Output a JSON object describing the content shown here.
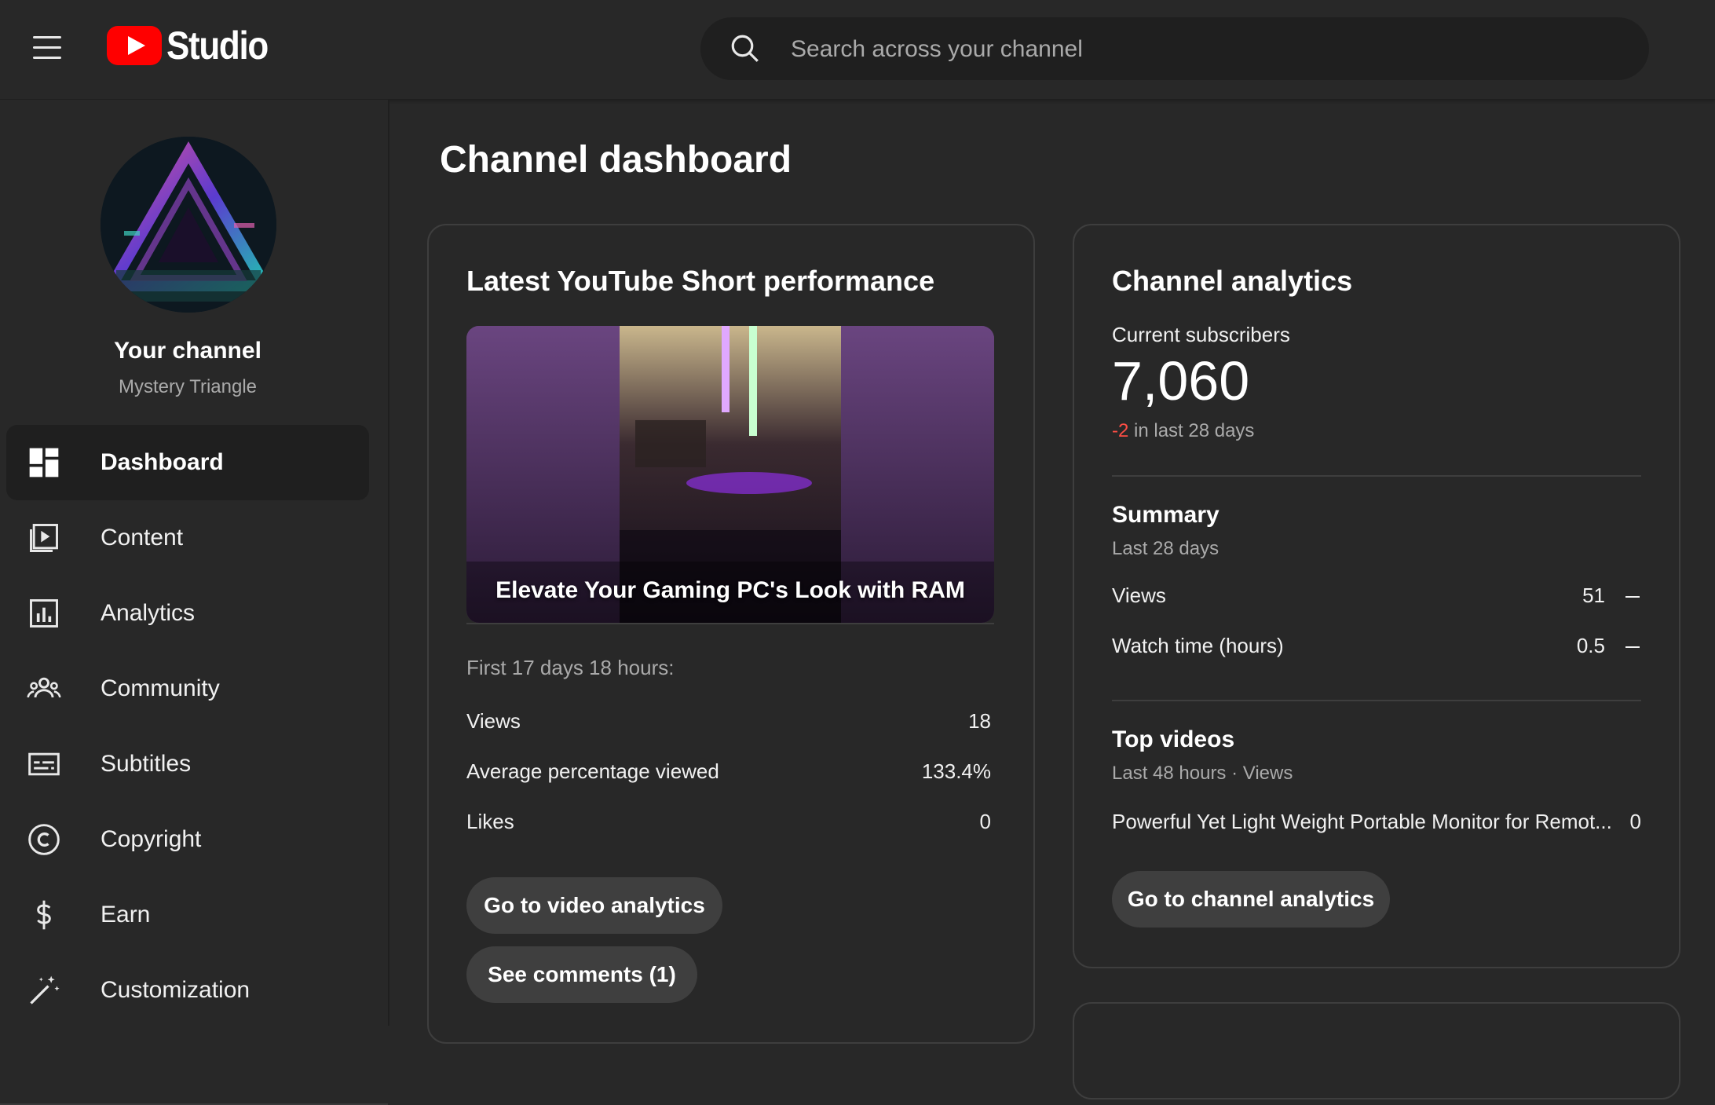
{
  "header": {
    "logo_text": "Studio",
    "search_placeholder": "Search across your channel"
  },
  "sidebar": {
    "channel_name": "Your channel",
    "channel_handle": "Mystery Triangle",
    "items": [
      {
        "label": "Dashboard",
        "icon": "dashboard-icon",
        "active": true
      },
      {
        "label": "Content",
        "icon": "content-icon"
      },
      {
        "label": "Analytics",
        "icon": "analytics-icon"
      },
      {
        "label": "Community",
        "icon": "community-icon"
      },
      {
        "label": "Subtitles",
        "icon": "subtitles-icon"
      },
      {
        "label": "Copyright",
        "icon": "copyright-icon"
      },
      {
        "label": "Earn",
        "icon": "earn-icon"
      },
      {
        "label": "Customization",
        "icon": "customization-icon"
      }
    ]
  },
  "main": {
    "title": "Channel dashboard",
    "short_card": {
      "title": "Latest YouTube Short performance",
      "video_title": "Elevate Your Gaming PC's Look with RAM",
      "period": "First 17 days 18 hours:",
      "stats": [
        {
          "label": "Views",
          "value": "18"
        },
        {
          "label": "Average percentage viewed",
          "value": "133.4%"
        },
        {
          "label": "Likes",
          "value": "0"
        }
      ],
      "buttons": [
        "Go to video analytics",
        "See comments (1)"
      ]
    },
    "analytics_card": {
      "title": "Channel analytics",
      "subscribers_label": "Current subscribers",
      "subscribers_value": "7,060",
      "subscribers_change": "-2",
      "subscribers_change_suffix": " in last 28 days",
      "summary_title": "Summary",
      "summary_period": "Last 28 days",
      "summary_rows": [
        {
          "label": "Views",
          "value": "51"
        },
        {
          "label": "Watch time (hours)",
          "value": "0.5"
        }
      ],
      "top_videos_title": "Top videos",
      "top_videos_period": "Last 48 hours · Views",
      "top_videos": [
        {
          "title": "Powerful Yet Light Weight Portable Monitor for Remot...",
          "views": "0"
        }
      ],
      "button": "Go to channel analytics"
    }
  },
  "colors": {
    "accent": "#ff0000",
    "negative": "#ff4e45",
    "background": "#282828"
  }
}
